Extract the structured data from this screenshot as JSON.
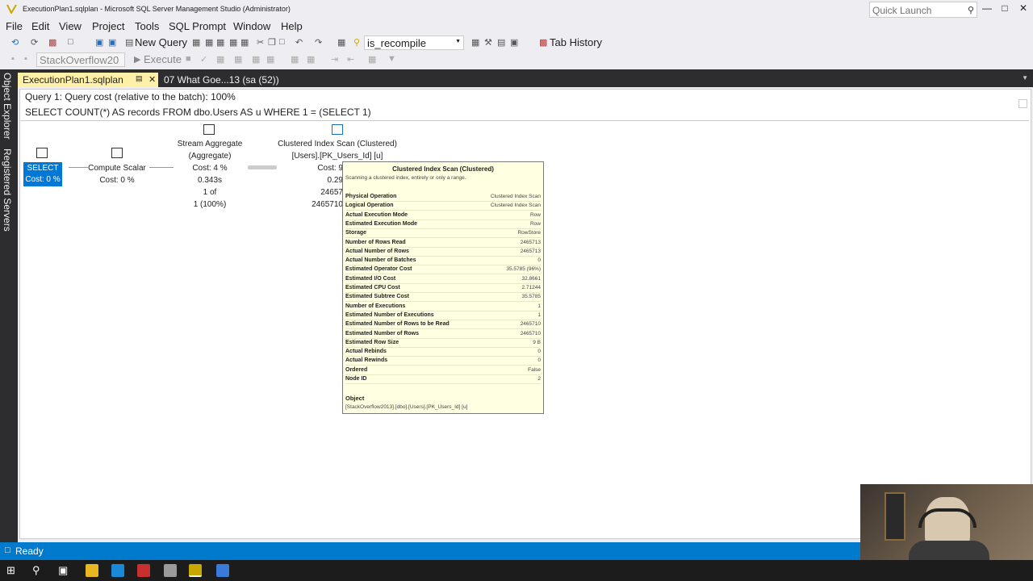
{
  "window": {
    "title": "ExecutionPlan1.sqlplan - Microsoft SQL Server Management Studio (Administrator)",
    "quick_launch_placeholder": "Quick Launch"
  },
  "menu": [
    "File",
    "Edit",
    "View",
    "Project",
    "Tools",
    "SQL Prompt",
    "Window",
    "Help"
  ],
  "toolbar": {
    "new_query": "New Query",
    "combo_value": "is_recompile",
    "tab_history": "Tab History",
    "database_value": "StackOverflow20",
    "execute": "Execute"
  },
  "sidebar": {
    "object_explorer": "Object Explorer",
    "registered_servers": "Registered Servers"
  },
  "doc_tabs": [
    {
      "label": "ExecutionPlan1.sqlplan"
    },
    {
      "label": "07 What Goe...13 (sa (52))"
    }
  ],
  "plan": {
    "query_line": "Query 1: Query cost (relative to the batch): 100%",
    "sql_line": "SELECT COUNT(*) AS records FROM dbo.Users AS u WHERE 1 = (SELECT 1)",
    "select_node": {
      "name": "SELECT",
      "cost": "Cost: 0 %"
    },
    "compute_node": {
      "name": "Compute Scalar",
      "cost": "Cost: 0 %"
    },
    "stream_node": {
      "name": "Stream Aggregate",
      "sub": "(Aggregate)",
      "cost": "Cost: 4 %",
      "time": "0.343s",
      "rows": "1 of",
      "pct": "1 (100%)"
    },
    "scan_node": {
      "name": "Clustered Index Scan (Clustered)",
      "sub": "[Users].[PK_Users_Id] [u]",
      "cost": "Cost: 9",
      "time": "0.29",
      "rows": "24657",
      "est": "2465710"
    }
  },
  "tooltip": {
    "title": "Clustered Index Scan (Clustered)",
    "desc": "Scanning a clustered index, entirely or only a range.",
    "rows": [
      {
        "k": "Physical Operation",
        "v": "Clustered Index Scan"
      },
      {
        "k": "Logical Operation",
        "v": "Clustered Index Scan"
      },
      {
        "k": "Actual Execution Mode",
        "v": "Row"
      },
      {
        "k": "Estimated Execution Mode",
        "v": "Row"
      },
      {
        "k": "Storage",
        "v": "RowStore"
      },
      {
        "k": "Number of Rows Read",
        "v": "2465713"
      },
      {
        "k": "Actual Number of Rows",
        "v": "2465713"
      },
      {
        "k": "Actual Number of Batches",
        "v": "0"
      },
      {
        "k": "Estimated Operator Cost",
        "v": "35.5785 (96%)"
      },
      {
        "k": "Estimated I/O Cost",
        "v": "32.8661"
      },
      {
        "k": "Estimated CPU Cost",
        "v": "2.71244"
      },
      {
        "k": "Estimated Subtree Cost",
        "v": "35.5785"
      },
      {
        "k": "Number of Executions",
        "v": "1"
      },
      {
        "k": "Estimated Number of Executions",
        "v": "1"
      },
      {
        "k": "Estimated Number of Rows to be Read",
        "v": "2465710"
      },
      {
        "k": "Estimated Number of Rows",
        "v": "2465710"
      },
      {
        "k": "Estimated Row Size",
        "v": "9 B"
      },
      {
        "k": "Actual Rebinds",
        "v": "0"
      },
      {
        "k": "Actual Rewinds",
        "v": "0"
      },
      {
        "k": "Ordered",
        "v": "False"
      },
      {
        "k": "Node ID",
        "v": "2"
      }
    ],
    "object_label": "Object",
    "object_value": "[StackOverflow2013].[dbo].[Users].[PK_Users_Id] [u]"
  },
  "status": {
    "text": "Ready"
  },
  "colors": {
    "accent": "#007acc",
    "tab_active": "#fff0a8",
    "select_highlight": "#0078d7",
    "tooltip_bg": "#ffffe1"
  }
}
